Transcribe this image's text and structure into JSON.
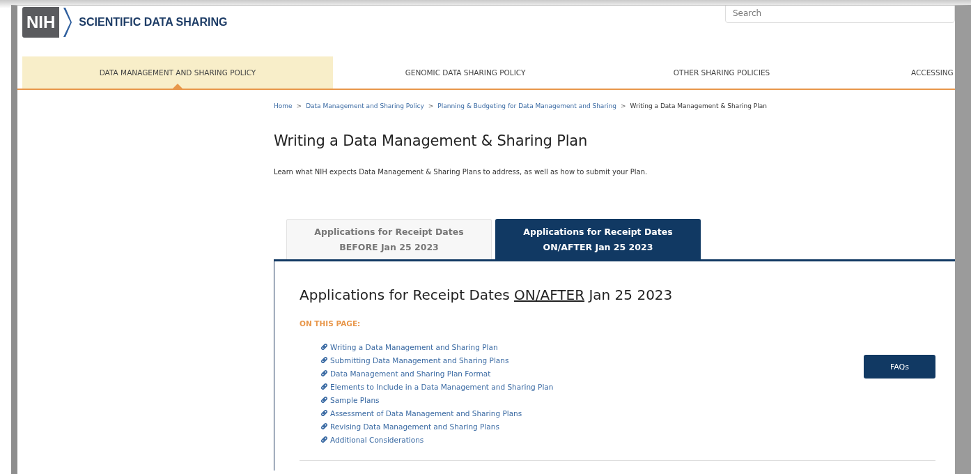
{
  "header": {
    "logo_mark": "NIH",
    "site_title": "SCIENTIFIC DATA SHARING",
    "search": {
      "placeholder": "Search"
    }
  },
  "nav": [
    {
      "label": "DATA MANAGEMENT AND SHARING POLICY",
      "selected": true
    },
    {
      "label": "GENOMIC DATA SHARING POLICY",
      "selected": false
    },
    {
      "label": "OTHER SHARING POLICIES",
      "selected": false
    },
    {
      "label": "ACCESSING",
      "selected": false
    }
  ],
  "breadcrumb_separator": ">",
  "breadcrumb": [
    {
      "label": "Home",
      "current": false
    },
    {
      "label": "Data Management and Sharing Policy",
      "current": false
    },
    {
      "label": "Planning & Budgeting for Data Management and Sharing",
      "current": false
    },
    {
      "label": "Writing a Data Management & Sharing Plan",
      "current": true
    }
  ],
  "page_title": "Writing a Data Management & Sharing Plan",
  "intro": "Learn what NIH expects Data Management & Sharing Plans to address, as well as how to submit your Plan.",
  "tabs": [
    {
      "line_1": "Applications for Receipt Dates",
      "line_2": "BEFORE Jan 25 2023",
      "selected": false
    },
    {
      "line_1": "Applications for Receipt Dates",
      "line_2": "ON/AFTER Jan 25 2023",
      "selected": true
    }
  ],
  "panel": {
    "heading": {
      "before": "Applications for Receipt Dates",
      "emphasis": "ON/AFTER",
      "after": "Jan 25 2023"
    },
    "on_this_page_label": "ON THIS PAGE:",
    "links": [
      "Writing a Data Management and Sharing Plan",
      "Submitting Data Management and Sharing Plans",
      "Data Management and Sharing Plan Format",
      "Elements to Include in a Data Management and Sharing Plan",
      "Sample Plans",
      "Assessment of Data Management and Sharing Plans",
      "Revising Data Management and Sharing Plans",
      "Additional Considerations"
    ],
    "faq_button": "FAQs"
  }
}
